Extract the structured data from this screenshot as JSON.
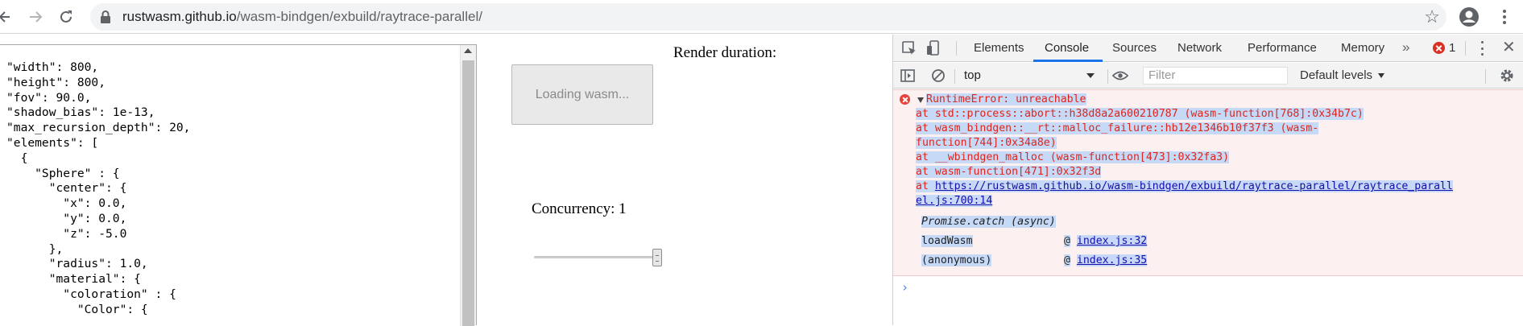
{
  "browser": {
    "url_host": "rustwasm.github.io",
    "url_path": "/wasm-bindgen/exbuild/raytrace-parallel/"
  },
  "page": {
    "config_text": "\"width\": 800,\n\"height\": 800,\n\"fov\": 90.0,\n\"shadow_bias\": 1e-13,\n\"max_recursion_depth\": 20,\n\"elements\": [\n  {\n    \"Sphere\" : {\n      \"center\": {\n        \"x\": 0.0,\n        \"y\": 0.0,\n        \"z\": -5.0\n      },\n      \"radius\": 1.0,\n      \"material\": {\n        \"coloration\" : {\n          \"Color\": {",
    "render_duration_label": "Render duration:",
    "load_button_label": "Loading wasm...",
    "concurrency_label": "Concurrency: 1",
    "concurrency_value": 1
  },
  "devtools": {
    "tabs": [
      {
        "label": "Elements",
        "active": false
      },
      {
        "label": "Console",
        "active": true
      },
      {
        "label": "Sources",
        "active": false
      },
      {
        "label": "Network",
        "active": false
      },
      {
        "label": "Performance",
        "active": false
      },
      {
        "label": "Memory",
        "active": false
      }
    ],
    "more_tabs": "»",
    "error_count": "1",
    "close_glyph": "✕",
    "context": "top",
    "filter_placeholder": "Filter",
    "levels_label": "Default levels",
    "error": {
      "message": "RuntimeError: unreachable",
      "stack": [
        "    at std::process::abort::h38d8a2a600210787 (wasm-function[768]:0x34b7c)",
        "    at wasm_bindgen::__rt::malloc_failure::hb12e1346b10f37f3 (wasm-",
        "function[744]:0x34a8e)",
        "    at __wbindgen_malloc (wasm-function[473]:0x32fa3)",
        "    at wasm-function[471]:0x32f3d"
      ],
      "url_prefix": "    at ",
      "url_line1": "https://rustwasm.github.io/wasm-bindgen/exbuild/raytrace-parallel/raytrace_parall",
      "url_line2": "el.js:700:14",
      "async_label": "Promise.catch (async)",
      "frames": [
        {
          "fn": "loadWasm",
          "at": "@",
          "src": "index.js:32"
        },
        {
          "fn": "(anonymous)",
          "at": "@",
          "src": "index.js:35"
        }
      ]
    },
    "prompt_glyph": "›"
  },
  "colors": {
    "error_red": "#e0251b",
    "accent_blue": "#1a73e8",
    "selection": "#c6d9f6"
  }
}
